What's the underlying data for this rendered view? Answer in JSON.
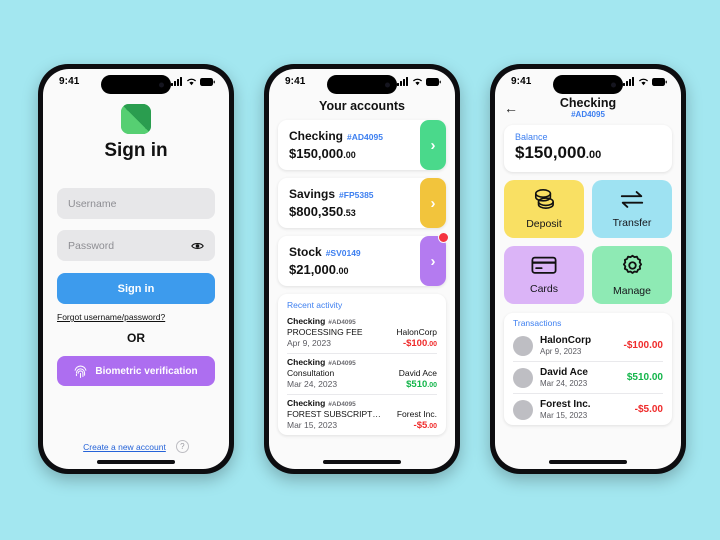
{
  "background_color": "#a3e7f0",
  "status_bar": {
    "time": "9:41"
  },
  "screen_signin": {
    "title": "Sign in",
    "username_placeholder": "Username",
    "password_placeholder": "Password",
    "signin_button": "Sign in",
    "forgot_link": "Forgot username/password?",
    "or_divider": "OR",
    "biometric_button": "Biometric verification",
    "create_account_link": "Create a new account",
    "help_label": "?"
  },
  "screen_accounts": {
    "title": "Your accounts",
    "accounts": [
      {
        "name": "Checking",
        "id": "#AD4095",
        "amount_main": "$150,000",
        "amount_cents": ".00",
        "tab_color": "#4ad98b",
        "has_badge": false
      },
      {
        "name": "Savings",
        "id": "#FP5385",
        "amount_main": "$800,350",
        "amount_cents": ".53",
        "tab_color": "#f2c43c",
        "has_badge": false
      },
      {
        "name": "Stock",
        "id": "#SV0149",
        "amount_main": "$21,000",
        "amount_cents": ".00",
        "tab_color": "#b47bf0",
        "has_badge": true
      }
    ],
    "activity_title": "Recent activity",
    "activity": [
      {
        "account": "Checking",
        "account_id": "#AD4095",
        "description": "PROCESSING FEE",
        "payee": "HalonCorp",
        "date": "Apr 9, 2023",
        "amount_main": "-$100",
        "amount_cents": ".00",
        "sign": "neg"
      },
      {
        "account": "Checking",
        "account_id": "#AD4095",
        "description": "Consultation",
        "payee": "David Ace",
        "date": "Mar 24, 2023",
        "amount_main": "$510",
        "amount_cents": ".00",
        "sign": "pos"
      },
      {
        "account": "Checking",
        "account_id": "#AD4095",
        "description": "FOREST SUBSCRIPTI…",
        "payee": "Forest Inc.",
        "date": "Mar 15, 2023",
        "amount_main": "-$5",
        "amount_cents": ".00",
        "sign": "neg"
      }
    ]
  },
  "screen_checking": {
    "title": "Checking",
    "account_id": "#AD4095",
    "balance_label": "Balance",
    "balance_main": "$150,000",
    "balance_cents": ".00",
    "tiles": [
      {
        "label": "Deposit",
        "color": "#f9e063",
        "icon": "coins-icon"
      },
      {
        "label": "Transfer",
        "color": "#9ee2f2",
        "icon": "transfer-arrows-icon"
      },
      {
        "label": "Cards",
        "color": "#dbb4f7",
        "icon": "credit-card-icon"
      },
      {
        "label": "Manage",
        "color": "#8eeab4",
        "icon": "gear-icon"
      }
    ],
    "transactions_title": "Transactions",
    "transactions": [
      {
        "name": "HalonCorp",
        "date": "Apr 9, 2023",
        "amount": "-$100.00",
        "sign": "neg"
      },
      {
        "name": "David Ace",
        "date": "Mar 24, 2023",
        "amount": "$510.00",
        "sign": "pos"
      },
      {
        "name": "Forest Inc.",
        "date": "Mar 15, 2023",
        "amount": "-$5.00",
        "sign": "neg"
      }
    ]
  }
}
